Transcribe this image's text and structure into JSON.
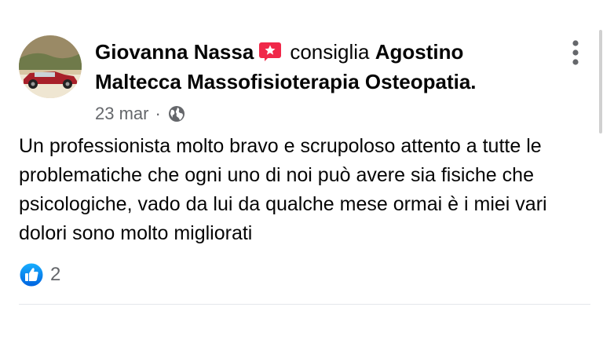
{
  "post": {
    "author": "Giovanna Nassa",
    "verb": "consiglia",
    "page_name_line1": "Agostino",
    "page_name_line2": "Maltecca Massofisioterapia Osteopatia.",
    "date": "23 mar",
    "separator": "·",
    "privacy_icon": "globe-icon",
    "recommend_badge_icon": "star-badge-icon",
    "body_text": "Un professionista molto bravo e scrupoloso attento a tutte le problematiche che ogni uno di noi può avere sia fisiche che psicologiche, vado da lui da qualche mese ormai è i miei vari dolori sono molto migliorati",
    "reactions": {
      "icon": "like-icon",
      "count": "2"
    }
  },
  "colors": {
    "text": "#050505",
    "secondary_text": "#65676b",
    "recommend_badge": "#f02849",
    "like_blue": "#1877f2",
    "divider": "#e4e6eb"
  }
}
